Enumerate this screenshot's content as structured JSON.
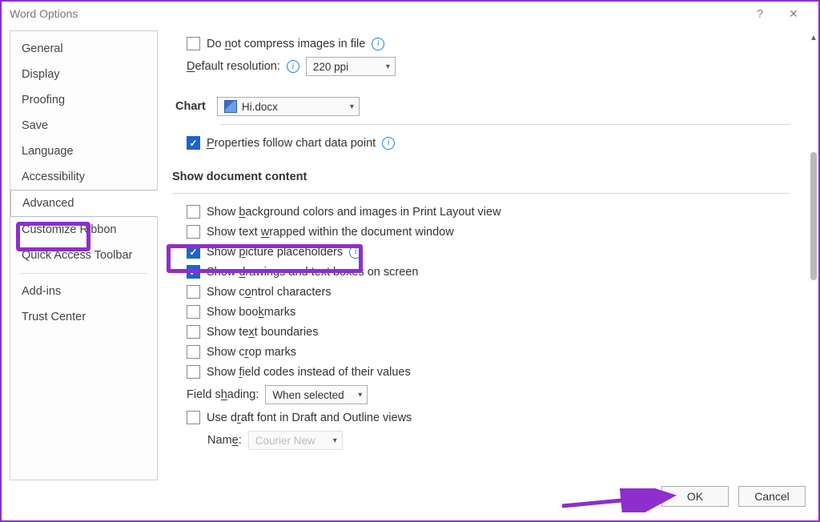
{
  "titlebar": {
    "title": "Word Options",
    "help": "?",
    "close": "✕"
  },
  "nav": {
    "items": [
      {
        "label": "General"
      },
      {
        "label": "Display"
      },
      {
        "label": "Proofing"
      },
      {
        "label": "Save"
      },
      {
        "label": "Language"
      },
      {
        "label": "Accessibility"
      },
      {
        "label": "Advanced",
        "selected": true
      },
      {
        "label": "Customize Ribbon"
      },
      {
        "label": "Quick Access Toolbar"
      },
      {
        "label": "Add-ins"
      },
      {
        "label": "Trust Center"
      }
    ]
  },
  "content": {
    "do_not_compress": "Do not compress images in file",
    "default_resolution_label": "Default resolution:",
    "default_resolution_value": "220 ppi",
    "chart_section": "Chart",
    "chart_doc": "Hi.docx",
    "props_follow": "Properties follow chart data point",
    "show_doc_content": "Show document content",
    "opt_background": "Show background colors and images in Print Layout view",
    "opt_text_wrapped": "Show text wrapped within the document window",
    "opt_pict_placeholders": "Show picture placeholders",
    "opt_drawings": "Show drawings and text boxes on screen",
    "opt_control_chars": "Show control characters",
    "opt_bookmarks": "Show bookmarks",
    "opt_text_boundaries": "Show text boundaries",
    "opt_crop_marks": "Show crop marks",
    "opt_field_codes": "Show field codes instead of their values",
    "field_shading_label": "Field shading:",
    "field_shading_value": "When selected",
    "opt_draft_font": "Use draft font in Draft and Outline views",
    "name_label": "Name:",
    "name_value": "Courier New"
  },
  "buttons": {
    "ok": "OK",
    "cancel": "Cancel"
  }
}
